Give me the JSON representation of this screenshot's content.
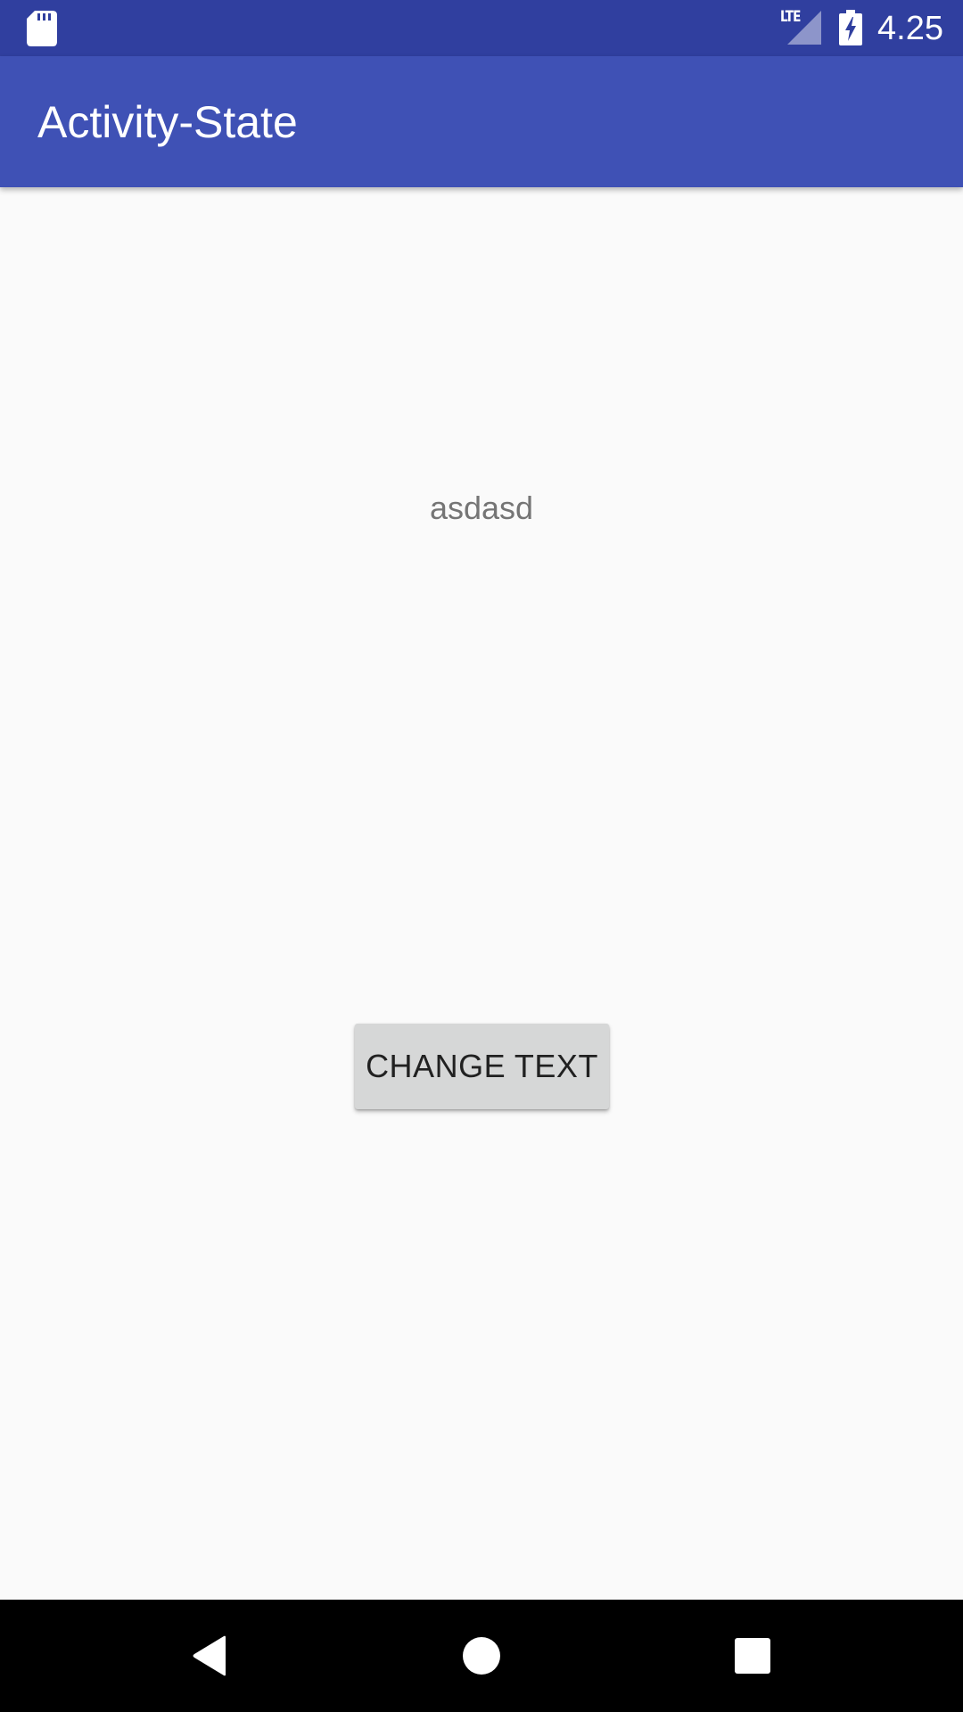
{
  "status_bar": {
    "time": "4.25",
    "network_label": "LTE",
    "icons": [
      "sd-card-icon",
      "signal-icon",
      "battery-charging-icon"
    ],
    "color": "#303f9f"
  },
  "app_bar": {
    "title": "Activity-State",
    "color": "#3f51b5"
  },
  "main": {
    "message": "asdasd",
    "change_button_label": "CHANGE TEXT"
  },
  "nav_bar": {
    "icons": [
      "back-icon",
      "home-icon",
      "recents-icon"
    ]
  }
}
